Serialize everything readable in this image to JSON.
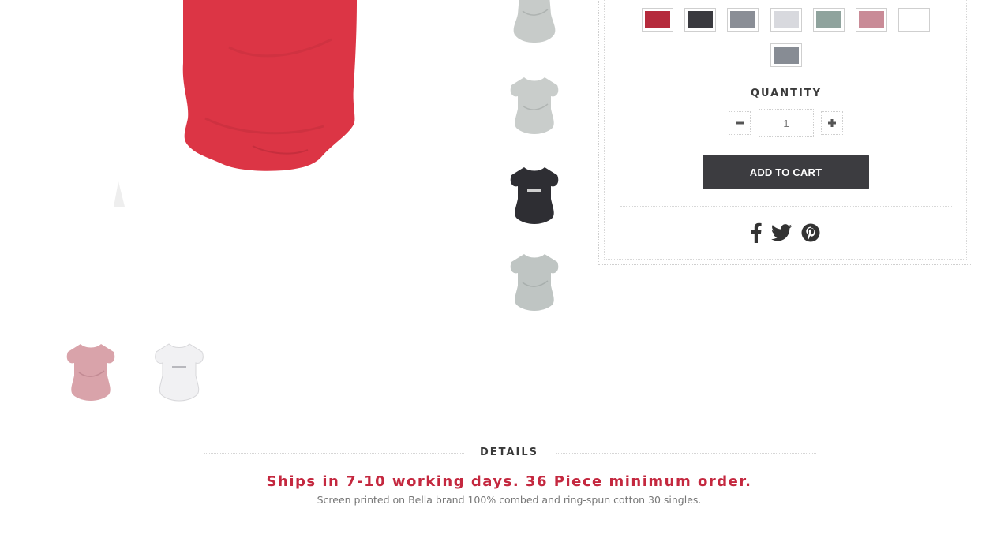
{
  "product": {
    "main_image_color": "#dc3545",
    "side_thumbnails": [
      {
        "icon": "onesie-heather-grey",
        "color": "#c7cbc9"
      },
      {
        "icon": "onesie-heather-grey",
        "color": "#c9cdcb"
      },
      {
        "icon": "onesie-charcoal",
        "color": "#2e2e33"
      },
      {
        "icon": "onesie-heather-grey",
        "color": "#bfc5c3"
      }
    ],
    "bottom_thumbnails": [
      {
        "icon": "onesie-heather-pink",
        "color": "#d9a3aa"
      },
      {
        "icon": "onesie-white",
        "color": "#eeeeee"
      }
    ]
  },
  "options": {
    "swatches": [
      {
        "name": "red",
        "color": "#b52a3c"
      },
      {
        "name": "charcoal",
        "color": "#3a3a3f"
      },
      {
        "name": "grey",
        "color": "#8a8e96"
      },
      {
        "name": "light-grey",
        "color": "#d8d9de"
      },
      {
        "name": "heather-green",
        "color": "#8fa39d"
      },
      {
        "name": "heather-pink",
        "color": "#c98b97"
      },
      {
        "name": "white",
        "color": "#ffffff"
      },
      {
        "name": "slate",
        "color": "#878c94"
      }
    ],
    "quantity_label": "QUANTITY",
    "quantity_value": "1",
    "decrement_icon": "minus-icon",
    "increment_icon": "plus-icon",
    "add_to_cart_label": "ADD TO CART",
    "share_icons": [
      "facebook-icon",
      "twitter-icon",
      "pinterest-icon"
    ]
  },
  "details": {
    "title": "DETAILS",
    "headline": "Ships in 7-10 working days. 36 Piece minimum order.",
    "description": "Screen printed on Bella brand 100% combed and ring-spun cotton 30 singles."
  },
  "colors": {
    "accent": "#c4283f",
    "button": "#3c3c40"
  }
}
